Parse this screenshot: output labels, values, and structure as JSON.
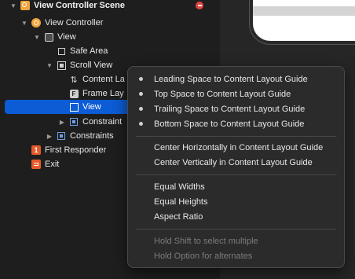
{
  "outline": {
    "scene_title": "View Controller Scene",
    "items": [
      {
        "label": "View Controller"
      },
      {
        "label": "View"
      },
      {
        "label": "Safe Area"
      },
      {
        "label": "Scroll View"
      },
      {
        "label": "Content La"
      },
      {
        "label": "Frame Lay"
      },
      {
        "label": "View"
      },
      {
        "label": "Constraint"
      },
      {
        "label": "Constraints"
      },
      {
        "label": "First Responder",
        "icon_text": "1"
      },
      {
        "label": "Exit"
      }
    ]
  },
  "menu": {
    "items": [
      {
        "label": "Leading Space to Content Layout Guide"
      },
      {
        "label": "Top Space to Content Layout Guide"
      },
      {
        "label": "Trailing Space to Content Layout Guide"
      },
      {
        "label": "Bottom Space to Content Layout Guide"
      },
      {
        "label": "Center Horizontally in Content Layout Guide"
      },
      {
        "label": "Center Vertically in Content Layout Guide"
      },
      {
        "label": "Equal Widths"
      },
      {
        "label": "Equal Heights"
      },
      {
        "label": "Aspect Ratio"
      },
      {
        "label": "Hold Shift to select multiple"
      },
      {
        "label": "Hold Option for alternates"
      }
    ]
  },
  "colors": {
    "selection": "#0b5cd5",
    "scene_icon": "#f2a33a",
    "responder_icon": "#e55a2a",
    "close_badge": "#e0443e"
  }
}
